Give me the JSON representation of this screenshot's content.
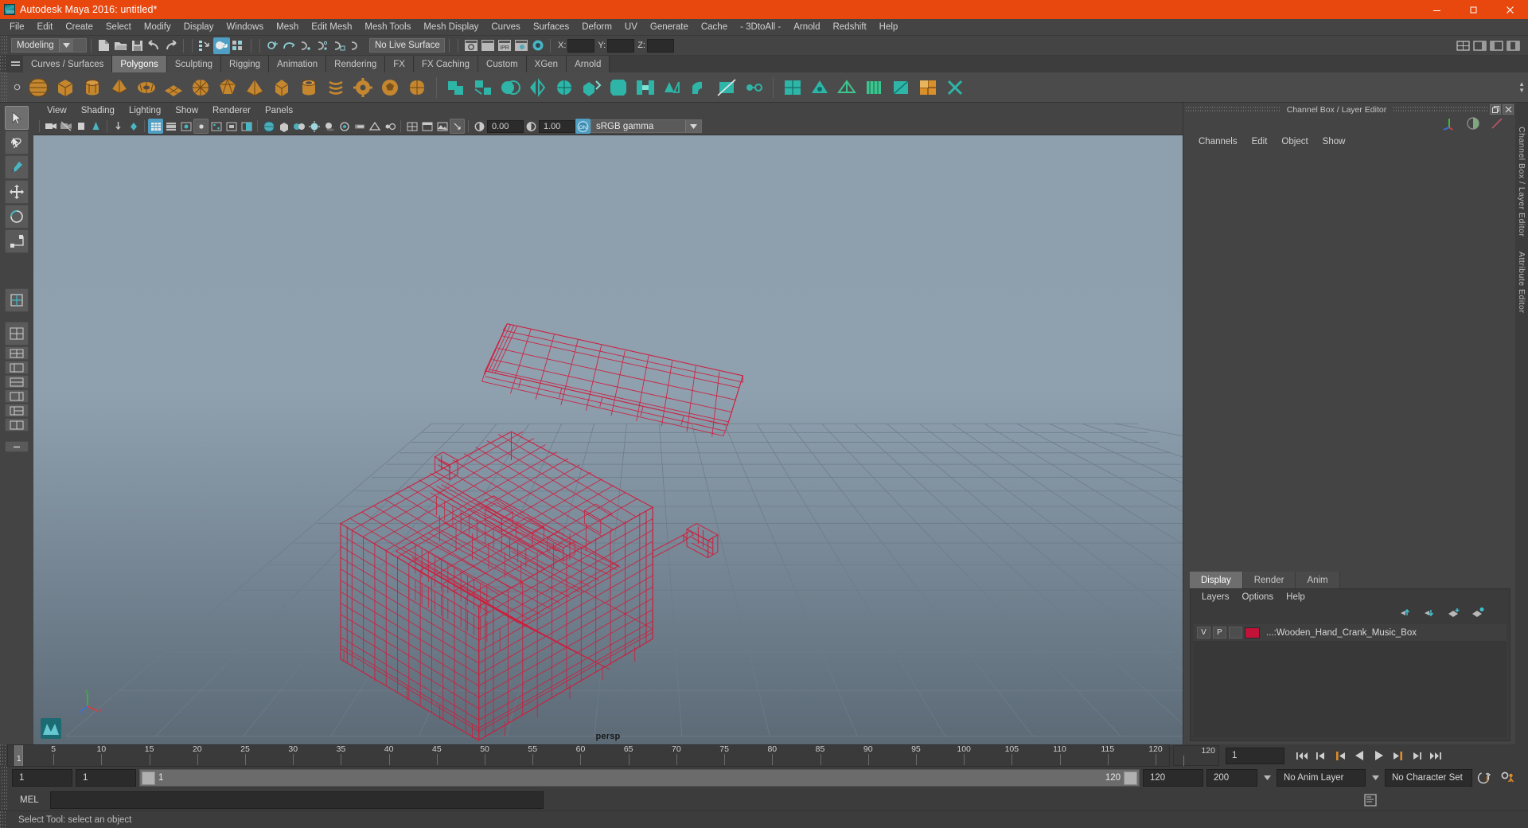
{
  "window": {
    "title": "Autodesk Maya 2016: untitled*",
    "app_icon": "maya-logo-icon",
    "minimize_label": "Minimize",
    "maximize_label": "Restore",
    "close_label": "Close",
    "title_bar_color": "#e8470e"
  },
  "menu": {
    "items": [
      "File",
      "Edit",
      "Create",
      "Select",
      "Modify",
      "Display",
      "Windows",
      "Mesh",
      "Edit Mesh",
      "Mesh Tools",
      "Mesh Display",
      "Curves",
      "Surfaces",
      "Deform",
      "UV",
      "Generate",
      "Cache",
      "- 3DtoAll -",
      "Arnold",
      "Redshift",
      "Help"
    ]
  },
  "status_bar": {
    "menu_set": "Modeling",
    "live_surface": "No Live Surface",
    "axis": {
      "x_label": "X:",
      "y_label": "Y:",
      "z_label": "Z:",
      "x_value": "",
      "y_value": "",
      "z_value": ""
    },
    "icons": [
      "new-scene-icon",
      "open-scene-icon",
      "save-scene-icon",
      "undo-icon",
      "redo-icon",
      "select-by-hierarchy-icon",
      "select-by-object-icon",
      "select-by-component-icon",
      "snap-to-grid-icon",
      "snap-to-curve-icon",
      "snap-to-point-icon",
      "snap-to-projected-center-icon",
      "snap-to-view-plane-icon",
      "make-live-icon",
      "render-current-frame-icon",
      "ipr-render-icon",
      "render-settings-icon",
      "hypershade-icon",
      "show-hide-editors-icon",
      "channel-box-toggle-icon",
      "attribute-editor-toggle-icon",
      "tool-settings-toggle-icon"
    ]
  },
  "shelf": {
    "tabs": [
      "Curves / Surfaces",
      "Polygons",
      "Sculpting",
      "Rigging",
      "Animation",
      "Rendering",
      "FX",
      "FX Caching",
      "Custom",
      "XGen",
      "Arnold"
    ],
    "selected_tab": "Polygons",
    "menu_icon": "shelf-menu-icon",
    "buttons": [
      "poly-sphere-icon",
      "poly-cube-icon",
      "poly-cylinder-icon",
      "poly-cone-icon",
      "poly-torus-icon",
      "poly-plane-icon",
      "poly-disc-icon",
      "poly-platonic-icon",
      "poly-pyramid-icon",
      "poly-prism-icon",
      "poly-pipe-icon",
      "poly-helix-icon",
      "poly-gear-icon",
      "poly-soccer-icon",
      "poly-superellipse-icon",
      "poly-combine-icon",
      "poly-separate-icon",
      "poly-booleans-icon",
      "poly-mirror-icon",
      "poly-smooth-icon",
      "poly-extrude-icon",
      "poly-bevel-icon",
      "poly-bridge-icon",
      "poly-append-icon",
      "poly-wedge-icon",
      "poly-multicut-icon",
      "poly-target-weld-icon",
      "poly-quad-draw-icon",
      "poly-sculpt-icon",
      "poly-crease-icon",
      "poly-reduce-icon",
      "poly-triangulate-icon",
      "poly-quadrangulate-icon",
      "uv-editor-icon",
      "poly-cleanup-icon"
    ]
  },
  "toolbox": {
    "tools": [
      {
        "name": "select-tool",
        "selected": true
      },
      {
        "name": "lasso-select-tool",
        "selected": false
      },
      {
        "name": "paint-select-tool",
        "selected": false
      },
      {
        "name": "move-tool",
        "selected": false
      },
      {
        "name": "rotate-tool",
        "selected": false
      },
      {
        "name": "scale-tool",
        "selected": false
      },
      {
        "name": "last-tool-used",
        "selected": false
      }
    ],
    "layout_presets": [
      "single-perspective-view-icon",
      "four-view-layout-icon",
      "outliner-persp-layout-icon",
      "persp-graph-layout-icon",
      "hypershade-persp-layout-icon",
      "outliner-persp-graph-layout-icon",
      "persp-layout-icon",
      "two-pane-layout-icon"
    ]
  },
  "viewport": {
    "menu": [
      "View",
      "Shading",
      "Lighting",
      "Show",
      "Renderer",
      "Panels"
    ],
    "camera_label": "persp",
    "exposure_value": "0.00",
    "gamma_value": "1.00",
    "color_space": "sRGB gamma",
    "color_management_state": "ON",
    "toolbar_icons": [
      "select-camera-icon",
      "lock-camera-icon",
      "camera-attributes-icon",
      "bookmark-icon",
      "image-plane-icon",
      "two-sided-lighting-icon",
      "grid-toggle-icon",
      "film-gate-icon",
      "resolution-gate-icon",
      "gate-mask-icon",
      "xray-icon",
      "xray-joints-icon",
      "wireframe-on-shaded-icon",
      "smooth-shade-all-icon",
      "hardware-texturing-icon",
      "use-all-lights-icon",
      "shadows-icon",
      "screen-space-ao-icon",
      "motion-blur-icon",
      "multisample-icon",
      "depth-of-field-icon",
      "isolate-select-icon",
      "grid-display-icon",
      "hud-icon",
      "exposure-icon",
      "gamma-icon",
      "color-management-icon"
    ],
    "model": {
      "name": "Wooden_Hand_Crank_Music_Box",
      "display_mode": "wireframe",
      "wire_color": "#d01d3c"
    },
    "axis_gizmo": {
      "x": "x",
      "y": "y",
      "z": "z"
    },
    "logo": "maya-viewport-logo-icon"
  },
  "right_panel": {
    "title": "Channel Box / Layer Editor",
    "restore_icon": "restore-panel-icon",
    "close_icon": "close-panel-icon",
    "header_icons": [
      "transform-axes-icon",
      "shading-half-icon",
      "diagonal-line-icon"
    ],
    "channel_menu": [
      "Channels",
      "Edit",
      "Object",
      "Show"
    ],
    "layer_editor": {
      "tabs": [
        "Display",
        "Render",
        "Anim"
      ],
      "selected_tab": "Display",
      "menu": [
        "Layers",
        "Options",
        "Help"
      ],
      "buttons": [
        "move-layer-up-icon",
        "move-layer-down-icon",
        "new-layer-icon",
        "new-layer-from-selected-icon"
      ],
      "layers": [
        {
          "visibility": "V",
          "playback": "P",
          "shading": "",
          "color": "#c1123a",
          "name": "...:Wooden_Hand_Crank_Music_Box"
        }
      ]
    },
    "side_tabs": [
      "Channel Box / Layer Editor",
      "Attribute Editor"
    ]
  },
  "timeline": {
    "ticks": [
      5,
      10,
      15,
      20,
      25,
      30,
      35,
      40,
      45,
      50,
      55,
      60,
      65,
      70,
      75,
      80,
      85,
      90,
      95,
      100,
      105,
      110,
      115,
      120
    ],
    "current_frame_marker": "1",
    "end_marker": "120",
    "current_frame_field": "1",
    "playback_buttons": [
      "go-to-start-icon",
      "step-back-keyframe-icon",
      "step-back-frame-icon",
      "play-backwards-icon",
      "play-forwards-icon",
      "step-forward-frame-icon",
      "step-forward-keyframe-icon",
      "go-to-end-icon"
    ]
  },
  "range": {
    "start_field": "1",
    "range_start_field": "1",
    "slider_start_label": "1",
    "slider_end_label": "120",
    "range_end_field": "120",
    "end_field": "200",
    "anim_layer": "No Anim Layer",
    "character_set": "No Character Set",
    "auto_key_icon": "auto-keyframe-icon",
    "anim_prefs_icon": "animation-preferences-icon"
  },
  "command_line": {
    "language_label": "MEL",
    "input_value": "",
    "script_editor_icon": "script-editor-icon"
  },
  "status_line": {
    "message": "Select Tool: select an object"
  },
  "help_line": {
    "help_icon": "help-icon"
  }
}
